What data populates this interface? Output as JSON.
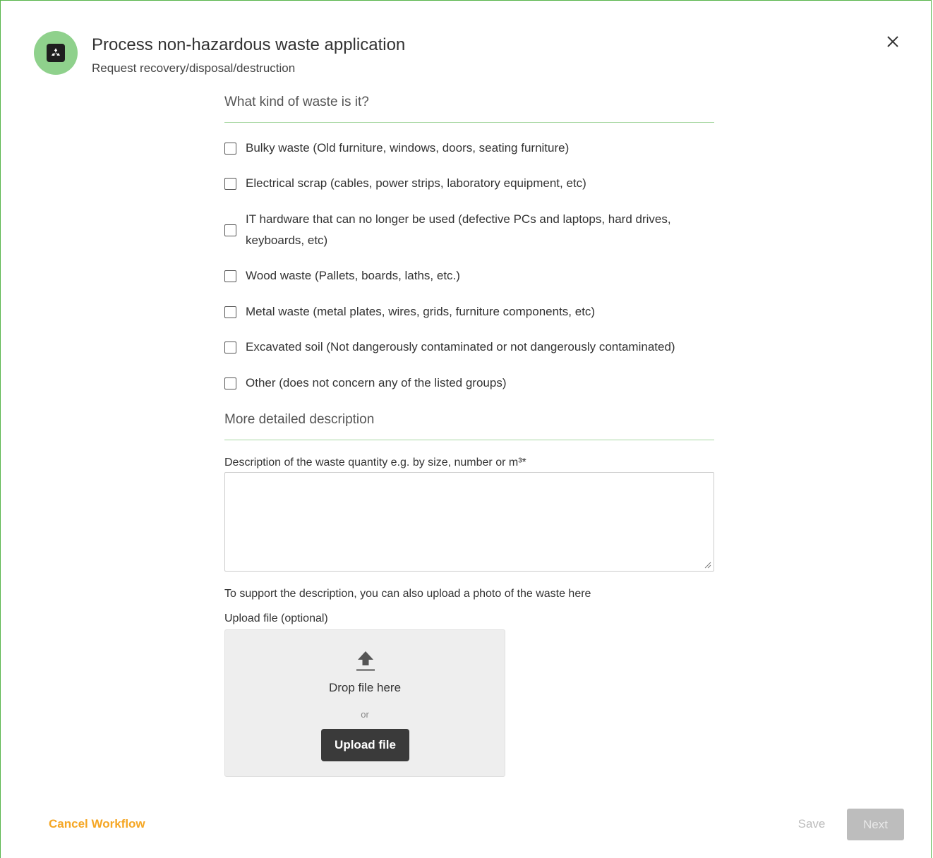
{
  "header": {
    "title": "Process non-hazardous waste application",
    "subtitle": "Request recovery/disposal/destruction",
    "icon": "recycle-icon",
    "icon_bg_color": "#8fd18c",
    "close_icon": "close-icon"
  },
  "form": {
    "section1_heading": "What kind of waste is it?",
    "waste_types": [
      {
        "label": "Bulky waste (Old furniture, windows, doors, seating furniture)",
        "checked": false
      },
      {
        "label": "Electrical scrap (cables, power strips, laboratory equipment, etc)",
        "checked": false
      },
      {
        "label": "IT hardware that can no longer be used (defective PCs and laptops, hard drives, keyboards, etc)",
        "checked": false
      },
      {
        "label": "Wood waste (Pallets, boards, laths, etc.)",
        "checked": false
      },
      {
        "label": "Metal waste (metal plates, wires, grids, furniture components, etc)",
        "checked": false
      },
      {
        "label": "Excavated soil (Not dangerously contaminated or not dangerously contaminated)",
        "checked": false
      },
      {
        "label": "Other (does not concern any of the listed groups)",
        "checked": false
      }
    ],
    "section2_heading": "More detailed description",
    "quantity_label": "Description of the waste quantity e.g. by size, number or m³*",
    "quantity_value": "",
    "photo_hint": "To support the description, you can also upload a photo of the waste here",
    "upload_label": "Upload file (optional)",
    "dropzone": {
      "icon": "upload-icon",
      "drop_text": "Drop file here",
      "or_text": "or",
      "button_label": "Upload file"
    }
  },
  "footer": {
    "cancel_label": "Cancel Workflow",
    "save_label": "Save",
    "next_label": "Next",
    "cancel_color": "#f5a623"
  }
}
